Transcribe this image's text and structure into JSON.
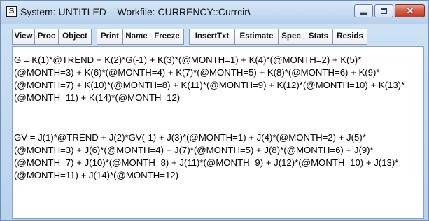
{
  "window": {
    "system_icon_letter": "S",
    "title": "System: UNTITLED    Workfile: CURRENCY::Currcir\\",
    "controls": {
      "minimize_icon": "minimize-icon",
      "maximize_icon": "maximize-icon",
      "close_icon": "close-icon",
      "close_color": "#c23a24"
    }
  },
  "toolbar": {
    "view": "View",
    "proc": "Proc",
    "object": "Object",
    "print": "Print",
    "name": "Name",
    "freeze": "Freeze",
    "inserttxt": "InsertTxt",
    "estimate": "Estimate",
    "spec": "Spec",
    "stats": "Stats",
    "resids": "Resids"
  },
  "editor": {
    "equation_g": "G = K(1)*@TREND + K(2)*G(-1) + K(3)*(@MONTH=1) + K(4)*(@MONTH=2) + K(5)*(@MONTH=3) + K(6)*(@MONTH=4) + K(7)*(@MONTH=5) + K(8)*(@MONTH=6) + K(9)*(@MONTH=7) + K(10)*(@MONTH=8) + K(11)*(@MONTH=9) + K(12)*(@MONTH=10) + K(13)*(@MONTH=11) + K(14)*(@MONTH=12)",
    "equation_gv": "GV = J(1)*@TREND + J(2)*GV(-1) + J(3)*(@MONTH=1) + J(4)*(@MONTH=2) + J(5)*(@MONTH=3) + J(6)*(@MONTH=4) + J(7)*(@MONTH=5) + J(8)*(@MONTH=6) + J(9)*(@MONTH=7) + J(10)*(@MONTH=8) + J(11)*(@MONTH=9) + J(12)*(@MONTH=10) + J(13)*(@MONTH=11) + J(14)*(@MONTH=12)"
  }
}
